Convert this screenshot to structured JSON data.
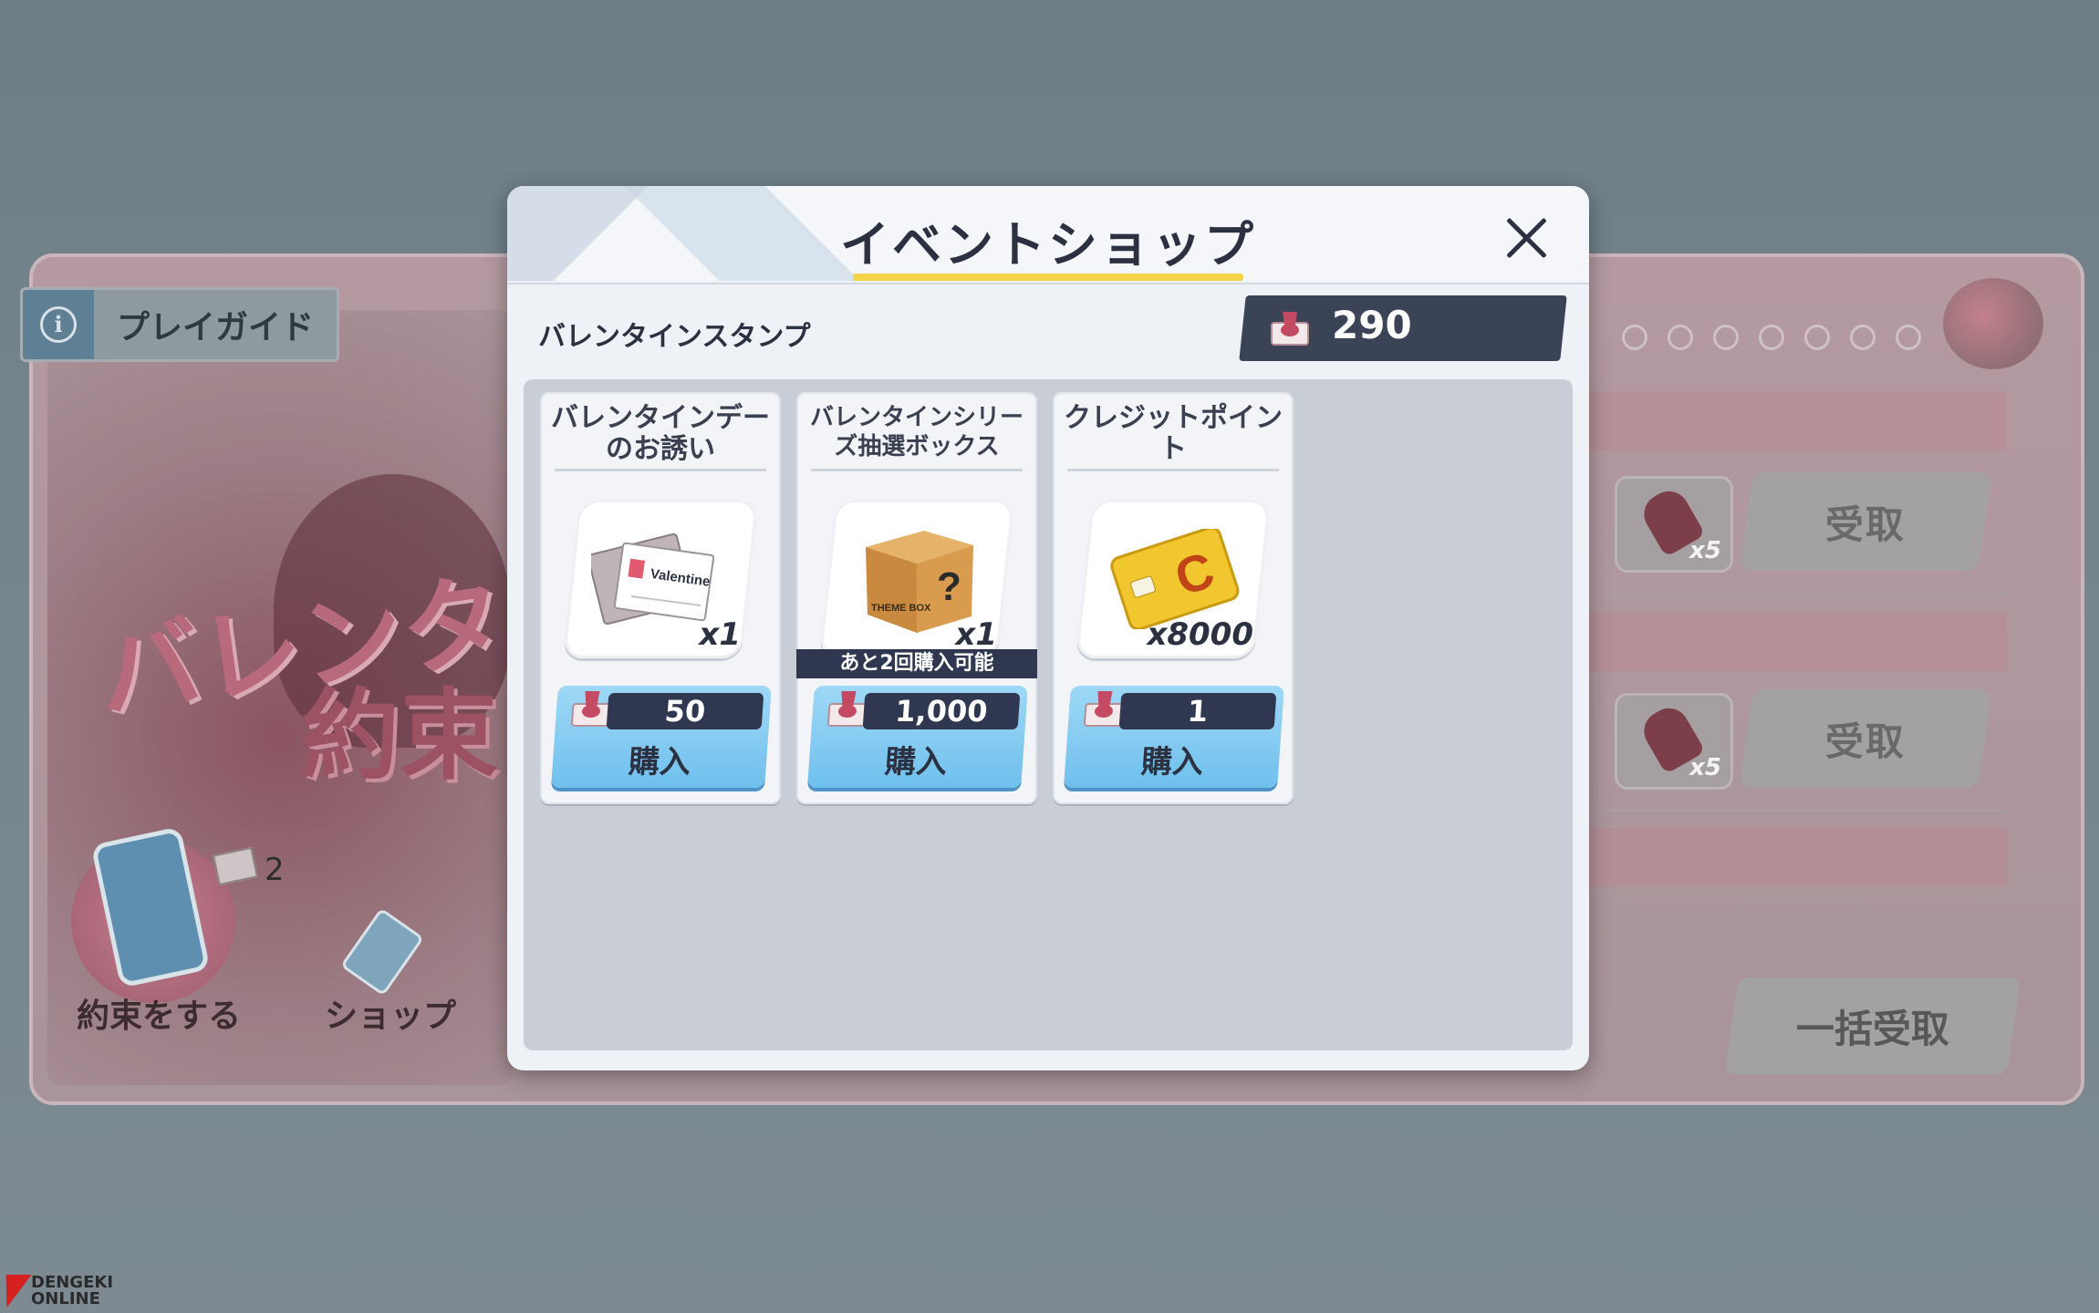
{
  "background": {
    "guide_label": "プレイガイド",
    "title_line1": "バレンタ",
    "title_line2": "約束",
    "promise_label": "約束をする",
    "promise_count": "2",
    "shop_label": "ショップ",
    "rows": [
      {
        "stamp_count": "x5",
        "button": "受取"
      },
      {
        "stamp_count": "x5",
        "button": "受取"
      }
    ],
    "bulk_button": "一括受取"
  },
  "watermark": {
    "line1": "DENGEKI",
    "line2": "ONLINE"
  },
  "modal": {
    "title": "イベントショップ",
    "currency_label": "バレンタインスタンプ",
    "currency_value": "290",
    "items": [
      {
        "name": "バレンタインデーのお誘い",
        "quantity": "x1",
        "price": "50",
        "buy_label": "購入",
        "icon": "valentine-letter-icon"
      },
      {
        "name": "バレンタインシリーズ抽選ボックス",
        "quantity": "x1",
        "limit": "あと2回購入可能",
        "price": "1,000",
        "buy_label": "購入",
        "icon": "theme-box-icon"
      },
      {
        "name": "クレジットポイント",
        "quantity": "x8000",
        "price": "1",
        "buy_label": "購入",
        "icon": "credit-card-icon"
      }
    ],
    "art_text": {
      "letter": "Valentine",
      "box": "THEME BOX",
      "card": "C"
    }
  },
  "colors": {
    "accent_yellow": "#f2d648",
    "navy": "#2f3850",
    "buy_blue": "#6fc0ee"
  }
}
